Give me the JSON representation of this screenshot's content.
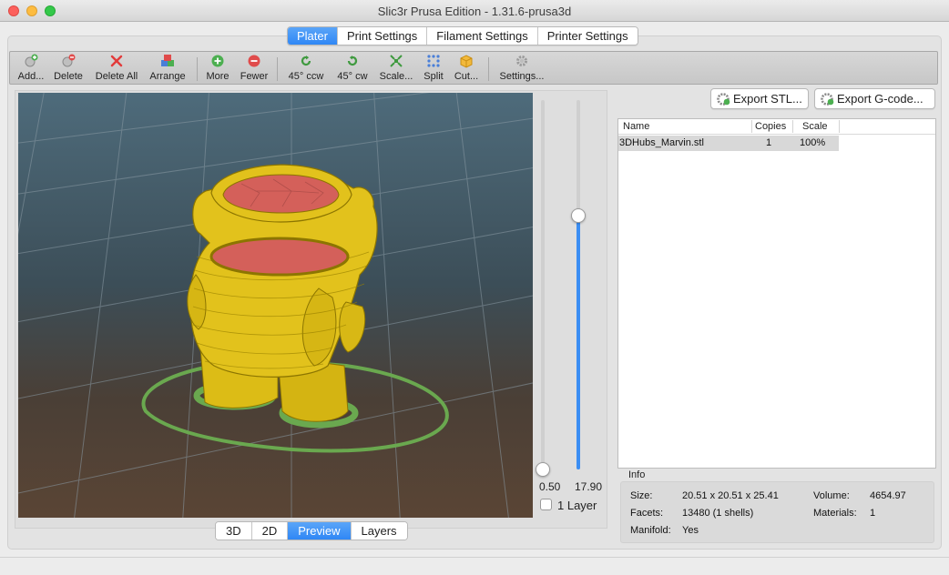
{
  "window": {
    "title": "Slic3r Prusa Edition - 1.31.6-prusa3d"
  },
  "main_tabs": [
    {
      "label": "Plater",
      "active": true
    },
    {
      "label": "Print Settings",
      "active": false
    },
    {
      "label": "Filament Settings",
      "active": false
    },
    {
      "label": "Printer Settings",
      "active": false
    }
  ],
  "toolbar": {
    "add": "Add...",
    "delete": "Delete",
    "delete_all": "Delete All",
    "arrange": "Arrange",
    "more": "More",
    "fewer": "Fewer",
    "rotate_ccw": "45° ccw",
    "rotate_cw": "45° cw",
    "scale": "Scale...",
    "split": "Split",
    "cut": "Cut...",
    "settings": "Settings..."
  },
  "layer_slider": {
    "low_value": "0.50",
    "high_value": "17.90",
    "one_layer_label": "1 Layer"
  },
  "view_tabs": [
    {
      "label": "3D",
      "active": false
    },
    {
      "label": "2D",
      "active": false
    },
    {
      "label": "Preview",
      "active": true
    },
    {
      "label": "Layers",
      "active": false
    }
  ],
  "export": {
    "stl": "Export STL...",
    "gcode": "Export G-code..."
  },
  "object_list": {
    "columns": [
      "Name",
      "Copies",
      "Scale"
    ],
    "rows": [
      {
        "name": "3DHubs_Marvin.stl",
        "copies": "1",
        "scale": "100%"
      }
    ]
  },
  "info": {
    "heading": "Info",
    "size_label": "Size:",
    "size": "20.51 x 20.51 x 25.41",
    "facets_label": "Facets:",
    "facets": "13480 (1 shells)",
    "manifold_label": "Manifold:",
    "manifold": "Yes",
    "volume_label": "Volume:",
    "volume": "4654.97",
    "materials_label": "Materials:",
    "materials": "1"
  },
  "colors": {
    "accent": "#3b8ef3",
    "model_yellow": "#e2c21c",
    "infill_red": "#d4605a",
    "skirt_green": "#6aa84f"
  }
}
